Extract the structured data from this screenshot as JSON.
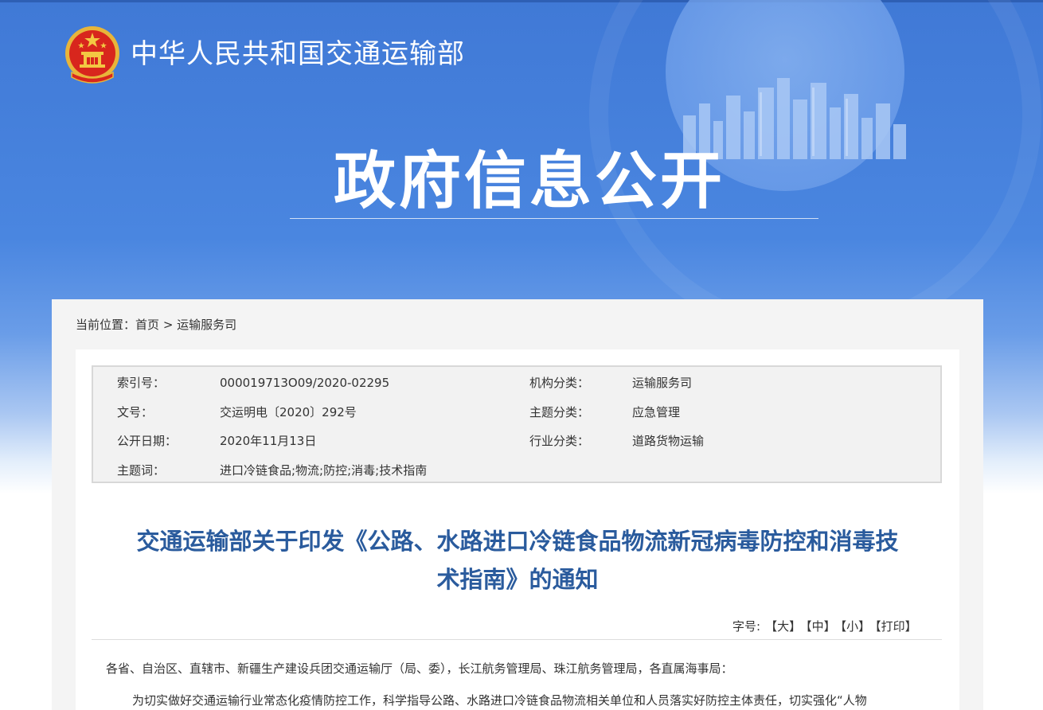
{
  "header": {
    "site_title": "中华人民共和国交通运输部",
    "hero_title": "政府信息公开",
    "emblem_icon": "national-emblem-icon"
  },
  "colors": {
    "banner_blue": "#4a86e0",
    "title_blue": "#2a5b9d",
    "text": "#333333"
  },
  "breadcrumb": {
    "prefix": "当前位置：",
    "home": "首页",
    "separator": ">",
    "current": "运输服务司"
  },
  "meta": {
    "index_label": "索引号：",
    "index_value": "000019713O09/2020-02295",
    "org_label": "机构分类：",
    "org_value": "运输服务司",
    "docno_label": "文号：",
    "docno_value": "交运明电〔2020〕292号",
    "topic_label": "主题分类：",
    "topic_value": "应急管理",
    "date_label": "公开日期：",
    "date_value": "2020年11月13日",
    "industry_label": "行业分类：",
    "industry_value": "道路货物运输",
    "keywords_label": "主题词：",
    "keywords_value": "进口冷链食品;物流;防控;消毒;技术指南"
  },
  "document": {
    "title_line1": "交通运输部关于印发《公路、水路进口冷链食品物流新冠病毒防控和消毒技",
    "title_line2": "术指南》的通知",
    "salutation": "各省、自治区、直辖市、新疆生产建设兵团交通运输厅（局、委），长江航务管理局、珠江航务管理局，各直属海事局：",
    "paragraph1": "为切实做好交通运输行业常态化疫情防控工作，科学指导公路、水路进口冷链食品物流相关单位和人员落实好防控主体责任，切实强化“人物"
  },
  "tools": {
    "label": "字号:",
    "large": "【大】",
    "medium": "【中】",
    "small": "【小】",
    "print": "【打印】"
  }
}
